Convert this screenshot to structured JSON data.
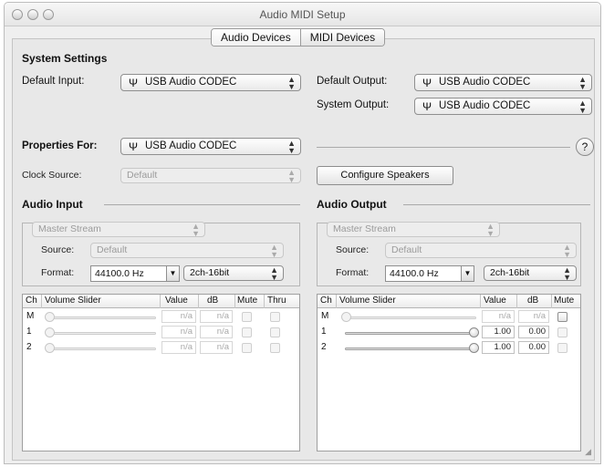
{
  "window": {
    "title": "Audio MIDI Setup"
  },
  "tabs": [
    {
      "label": "Audio Devices",
      "selected": true
    },
    {
      "label": "MIDI Devices",
      "selected": false
    }
  ],
  "system_settings": {
    "heading": "System Settings",
    "default_input_label": "Default Input:",
    "default_input_value": "USB Audio CODEC",
    "default_output_label": "Default Output:",
    "default_output_value": "USB Audio CODEC",
    "system_output_label": "System Output:",
    "system_output_value": "USB Audio CODEC"
  },
  "properties": {
    "label": "Properties For:",
    "value": "USB Audio CODEC",
    "help_glyph": "?",
    "clock_source_label": "Clock Source:",
    "clock_source_value": "Default",
    "configure_speakers": "Configure Speakers"
  },
  "audio_input": {
    "heading": "Audio Input",
    "stream": "Master Stream",
    "source_label": "Source:",
    "source_value": "Default",
    "format_label": "Format:",
    "rate": "44100.0 Hz",
    "bits": "2ch-16bit",
    "columns": [
      "Ch",
      "Volume Slider",
      "Value",
      "dB",
      "Mute",
      "Thru"
    ],
    "rows": [
      {
        "ch": "M",
        "level": 0,
        "value": "n/a",
        "db": "n/a",
        "mute": false,
        "thru": false
      },
      {
        "ch": "1",
        "level": 0,
        "value": "n/a",
        "db": "n/a",
        "mute": false,
        "thru": false
      },
      {
        "ch": "2",
        "level": 0,
        "value": "n/a",
        "db": "n/a",
        "mute": false,
        "thru": false
      }
    ]
  },
  "audio_output": {
    "heading": "Audio Output",
    "stream": "Master Stream",
    "source_label": "Source:",
    "source_value": "Default",
    "format_label": "Format:",
    "rate": "44100.0 Hz",
    "bits": "2ch-16bit",
    "columns": [
      "Ch",
      "Volume Slider",
      "Value",
      "dB",
      "Mute"
    ],
    "rows": [
      {
        "ch": "M",
        "level": 0,
        "value": "n/a",
        "db": "n/a",
        "mute": false
      },
      {
        "ch": "1",
        "level": 1.0,
        "value": "1.00",
        "db": "0.00",
        "mute": false
      },
      {
        "ch": "2",
        "level": 1.0,
        "value": "1.00",
        "db": "0.00",
        "mute": false
      }
    ]
  },
  "icons": {
    "usb": "usb-icon",
    "popup_arrows": "up-down-arrows-icon",
    "dropdown": "dropdown-arrow-icon"
  }
}
